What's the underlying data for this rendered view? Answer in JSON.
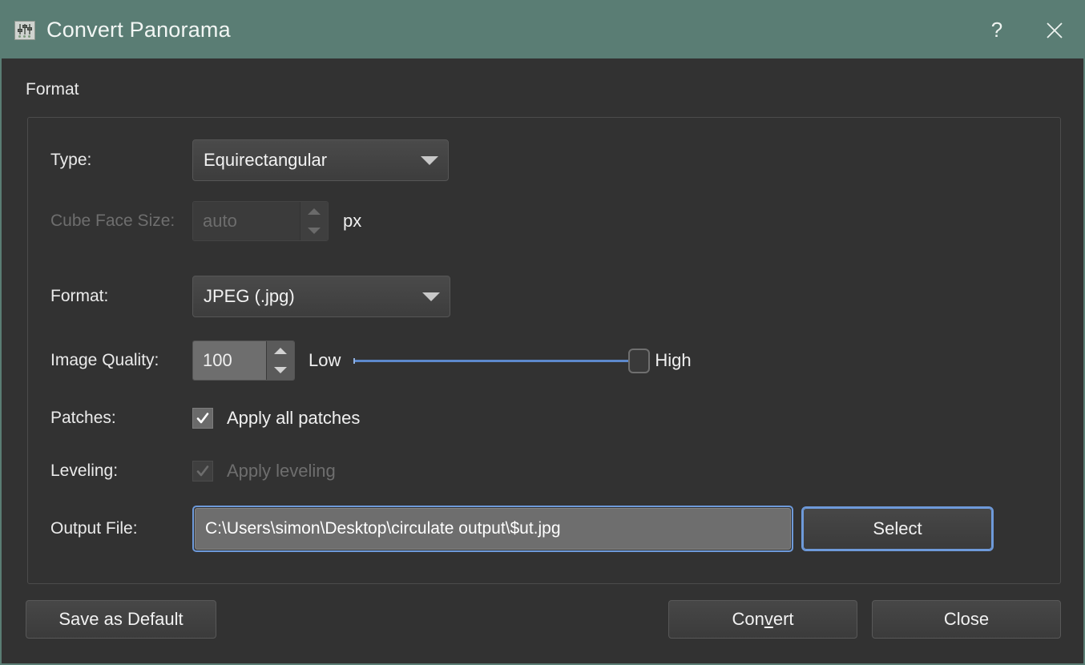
{
  "window": {
    "title": "Convert Panorama",
    "title_icon": "sliders-icon",
    "titlebar_color": "#5a7d74",
    "help_label": "?",
    "close_icon": "close-icon"
  },
  "format_section": {
    "label": "Format",
    "type_row": {
      "label": "Type:",
      "value": "Equirectangular",
      "caret_icon": "chevron-down-icon"
    },
    "cube_face_size_row": {
      "label": "Cube Face Size:",
      "value": "auto",
      "placeholder": "auto",
      "unit": "px",
      "disabled": true,
      "spinner_up_icon": "triangle-up-icon",
      "spinner_down_icon": "triangle-down-icon"
    },
    "file_format_row": {
      "label": "Format:",
      "value": "JPEG (.jpg)",
      "caret_icon": "chevron-down-icon"
    },
    "image_quality_row": {
      "label": "Image Quality:",
      "value": "100",
      "slider_min_label": "Low",
      "slider_max_label": "High",
      "slider_value": 100,
      "slider_min": 0,
      "slider_max": 100,
      "track_color": "#5d89cc",
      "spinner_up_icon": "triangle-up-icon",
      "spinner_down_icon": "triangle-down-icon"
    },
    "patches_row": {
      "label": "Patches:",
      "checkbox_label": "Apply all patches",
      "checked": true,
      "disabled": false,
      "check_icon": "checkmark-icon"
    },
    "leveling_row": {
      "label": "Leveling:",
      "checkbox_label": "Apply leveling",
      "checked": true,
      "disabled": true,
      "check_icon": "checkmark-icon"
    },
    "output_file_row": {
      "label": "Output File:",
      "value": "C:\\Users\\simon\\Desktop\\circulate output\\$ut.jpg",
      "placeholder": "",
      "select_label": "Select",
      "focus_color": "#6e9ada"
    }
  },
  "footer": {
    "save_as_default_label": "Save as Default",
    "convert_label_before": "Con",
    "convert_mnemonic": "v",
    "convert_label_after": "ert",
    "close_label": "Close"
  }
}
